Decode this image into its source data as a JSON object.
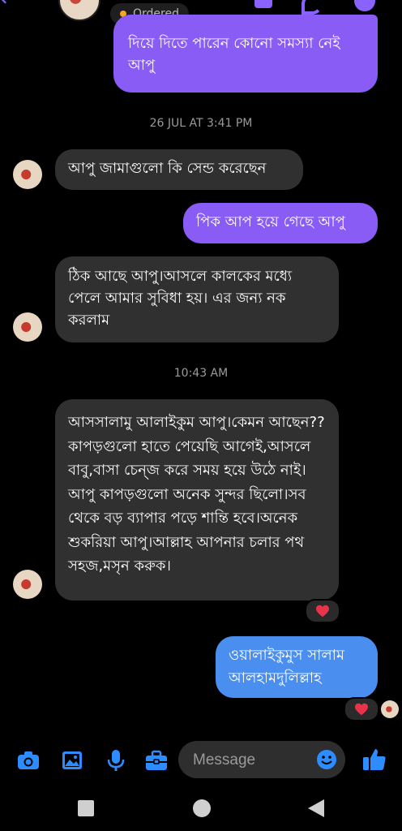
{
  "header": {
    "status": "Ordered"
  },
  "messages": {
    "m1": "দিয়ে দিতে পারেন কোনো সমস্যা নেই আপু",
    "timestamp1": "26 JUL AT 3:41 PM",
    "m2": "আপু জামাগুলো কি সেন্ড করেছেন",
    "m3": "পিক আপ হয়ে গেছে আপু",
    "m4": "ঠিক আছে আপু।আসলে কালকের মধ্যে পেলে আমার সুবিধা হয়। এর জন্য নক করলাম",
    "timestamp2": "10:43 AM",
    "m5": "আসসালামু আলাইকুম আপু।কেমন আছেন??কাপড়গুলো হাতে পেয়েছি আগেই,আসলে বাবু,বাসা চেন্জ করে সময় হয়ে উঠে নাই।আপু কাপড়গুলো অনেক সুন্দর ছিলো।সব থেকে বড় ব্যাপার পড়ে শান্তি হবে।অনেক শুকরিয়া আপু।আল্লাহ আপনার চলার পথ সহজ,মসৃন করুক।",
    "m6": "ওয়ালাইকুমুস সালাম আলহামদুলিল্লাহ"
  },
  "composer": {
    "placeholder": "Message"
  },
  "colors": {
    "accent": "#8a5cf6",
    "blue_bubble": "#4a8ff0",
    "received_bubble": "#303030",
    "heart": "#e8334a",
    "status_dot": "#f5a623"
  },
  "icons": [
    "back-arrow-icon",
    "video-call-icon",
    "phone-icon",
    "info-icon",
    "camera-icon",
    "gallery-icon",
    "microphone-icon",
    "briefcase-icon",
    "emoji-icon",
    "like-icon"
  ]
}
